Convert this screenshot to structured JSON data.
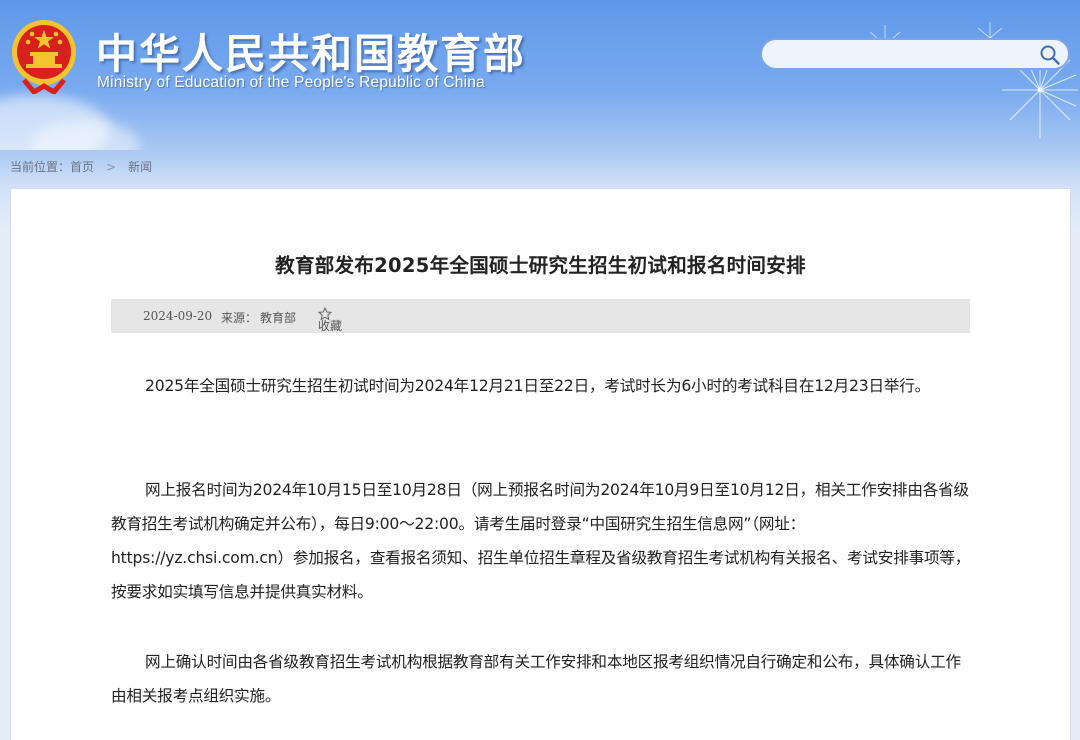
{
  "header": {
    "title": "中华人民共和国教育部",
    "subtitle": "Ministry of Education of the People's Republic of China",
    "emblem_icon": "national-emblem-icon"
  },
  "search": {
    "placeholder": "",
    "icon": "search-icon"
  },
  "breadcrumb": {
    "label": "当前位置：",
    "items": [
      "首页",
      "新闻"
    ],
    "separator": ">"
  },
  "article": {
    "title": "教育部发布2025年全国硕士研究生招生初试和报名时间安排",
    "date": "2024-09-20",
    "source_label": "来源：",
    "source": "教育部",
    "favorite_label": "收藏",
    "favorite_icon": "star-outline-icon",
    "paragraphs": [
      "2025年全国硕士研究生招生初试时间为2024年12月21日至22日，考试时长为6小时的考试科目在12月23日举行。",
      "网上报名时间为2024年10月15日至10月28日（网上预报名时间为2024年10月9日至10月12日，相关工作安排由各省级教育招生考试机构确定并公布），每日9:00～22:00。请考生届时登录“中国研究生招生信息网”（网址：https://yz.chsi.com.cn）参加报名，查看报名须知、招生单位招生章程及省级教育招生考试机构有关报名、考试安排事项等，按要求如实填写信息并提供真实材料。",
      "网上确认时间由各省级教育招生考试机构根据教育部有关工作安排和本地区报考组织情况自行确定和公布，具体确认工作由相关报考点组织实施。"
    ]
  },
  "colors": {
    "header_blue": "#5f98ea",
    "emblem_red": "#d8201c",
    "emblem_gold": "#f4c430",
    "meta_bg": "#e6e6e6"
  }
}
